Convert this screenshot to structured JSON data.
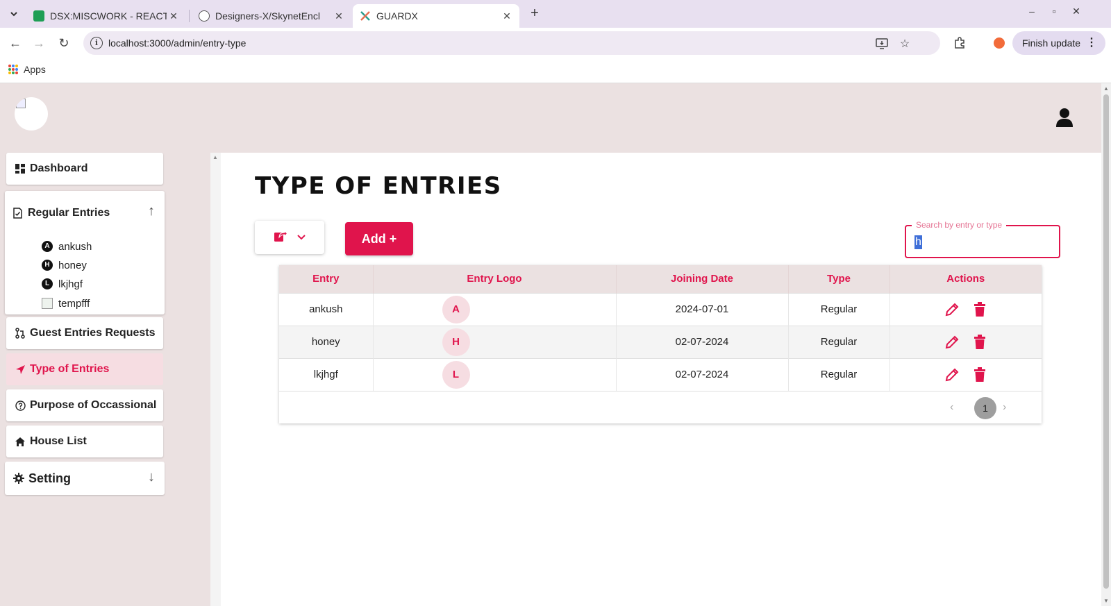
{
  "browser": {
    "tabs": [
      {
        "title": "DSX:MISCWORK - REACT",
        "active": false
      },
      {
        "title": "Designers-X/SkynetEncl",
        "active": false
      },
      {
        "title": "GUARDX",
        "active": true
      }
    ],
    "url": "localhost:3000/admin/entry-type",
    "finish_update": "Finish update",
    "bookmarks_apps": "Apps"
  },
  "sidebar": {
    "dashboard": "Dashboard",
    "regular_entries": {
      "label": "Regular Entries",
      "items": [
        {
          "badge": "A",
          "label": "ankush"
        },
        {
          "badge": "H",
          "label": "honey"
        },
        {
          "badge": "L",
          "label": "lkjhgf"
        },
        {
          "badge": "",
          "label": "tempfff"
        }
      ]
    },
    "guest_requests": "Guest Entries Requests",
    "type_of_entries": "Type of Entries",
    "purpose": "Purpose of Occassional",
    "house_list": "House List",
    "setting": "Setting"
  },
  "main": {
    "title": "TYPE OF ENTRIES",
    "add_button": "Add +",
    "search": {
      "label": "Search by entry or type",
      "value": "h"
    },
    "table": {
      "columns": [
        "Entry",
        "Entry Logo",
        "Joining Date",
        "Type",
        "Actions"
      ],
      "rows": [
        {
          "entry": "ankush",
          "logo": "A",
          "date": "2024-07-01",
          "type": "Regular"
        },
        {
          "entry": "honey",
          "logo": "H",
          "date": "02-07-2024",
          "type": "Regular"
        },
        {
          "entry": "lkjhgf",
          "logo": "L",
          "date": "02-07-2024",
          "type": "Regular"
        }
      ]
    },
    "pagination": {
      "current": "1"
    }
  },
  "colors": {
    "accent": "#e0144c",
    "accent_light": "#f6dde2",
    "app_bg": "#ebe1e1",
    "browser_frame": "#e8e0f0"
  }
}
